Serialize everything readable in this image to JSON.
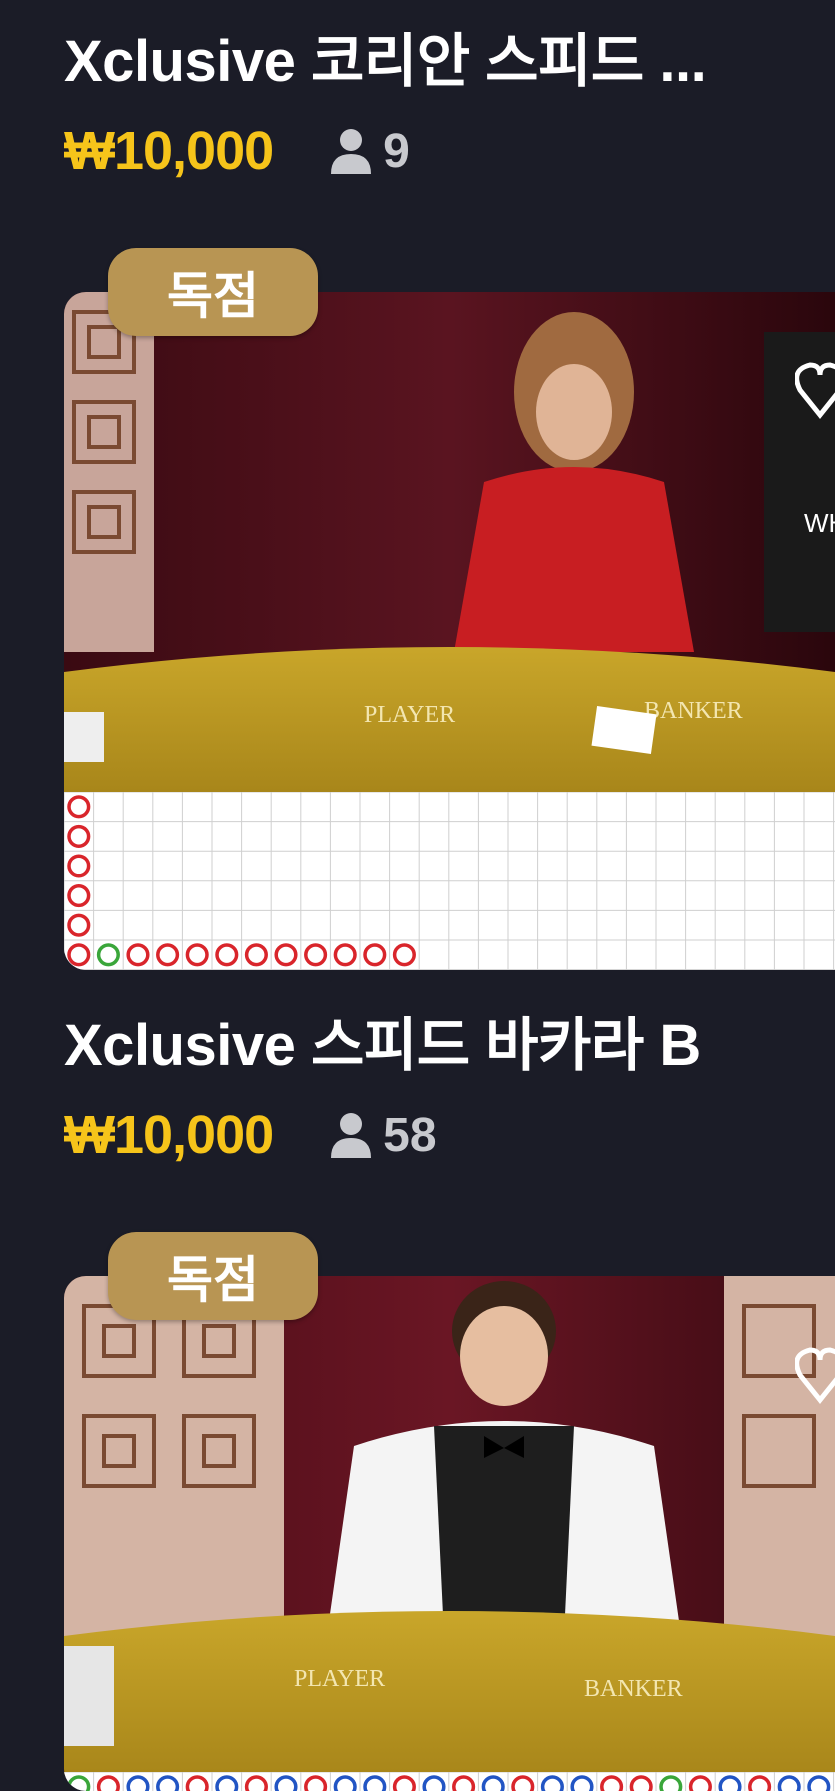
{
  "games": [
    {
      "title": "Xclusive 코리안 스피드 ...",
      "price": "₩10,000",
      "players": "9"
    },
    {
      "badge": "독점",
      "table_labels": {
        "player": "PLAYER",
        "banker": "BANKER"
      },
      "title": "Xclusive 스피드 바카라 B",
      "price": "₩10,000",
      "players": "58"
    },
    {
      "badge": "독점",
      "table_labels": {
        "player": "PLAYER",
        "banker": "BANKER"
      }
    }
  ],
  "colors": {
    "background": "#1b1c27",
    "price": "#f6c41a",
    "badge": "#b89553",
    "banker_bead": "#d9252b",
    "player_bead": "#2255c4",
    "tie_bead": "#3aa63a"
  },
  "icons": [
    "user-icon",
    "heart-icon"
  ]
}
